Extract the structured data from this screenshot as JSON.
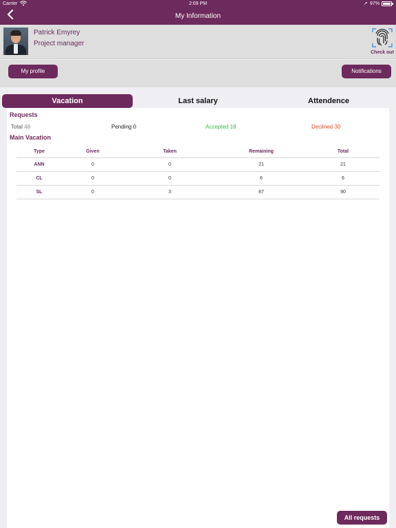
{
  "status_bar": {
    "carrier": "Carrier",
    "time": "2:09 PM",
    "battery": "97%",
    "wifi_icon": "wifi-icon",
    "location_icon": "location-arrow-icon",
    "battery_icon": "battery-icon"
  },
  "nav": {
    "title": "My Information",
    "back_icon": "chevron-left-icon"
  },
  "profile": {
    "name": "Patrick Emyrey",
    "role": "Project manager",
    "checkout_label": "Check out",
    "checkout_icon": "fingerprint-icon"
  },
  "actions": {
    "my_profile": "My profile",
    "notifications": "Notifications"
  },
  "tabs": [
    {
      "label": "Vacation",
      "active": true
    },
    {
      "label": "Last salary",
      "active": false
    },
    {
      "label": "Attendence",
      "active": false
    }
  ],
  "requests": {
    "title": "Requests",
    "total_label": "Total",
    "total": "48",
    "pending_label": "Pending",
    "pending": "0",
    "accepted_label": "Accepted",
    "accepted": "18",
    "declined_label": "Declined",
    "declined": "30"
  },
  "main_vacation": {
    "title": "Main Vacation",
    "headers": [
      "Type",
      "Given",
      "Taken",
      "Remaining",
      "Total"
    ],
    "rows": [
      [
        "ANN",
        "0",
        "0",
        "21",
        "21"
      ],
      [
        "CL",
        "0",
        "0",
        "6",
        "6"
      ],
      [
        "SL",
        "0",
        "3",
        "87",
        "90"
      ]
    ]
  },
  "all_requests": "All requests",
  "colors": {
    "brand": "#6d2a5c",
    "accepted": "#3bb84a",
    "declined": "#e0442a",
    "background": "#efeef3"
  }
}
